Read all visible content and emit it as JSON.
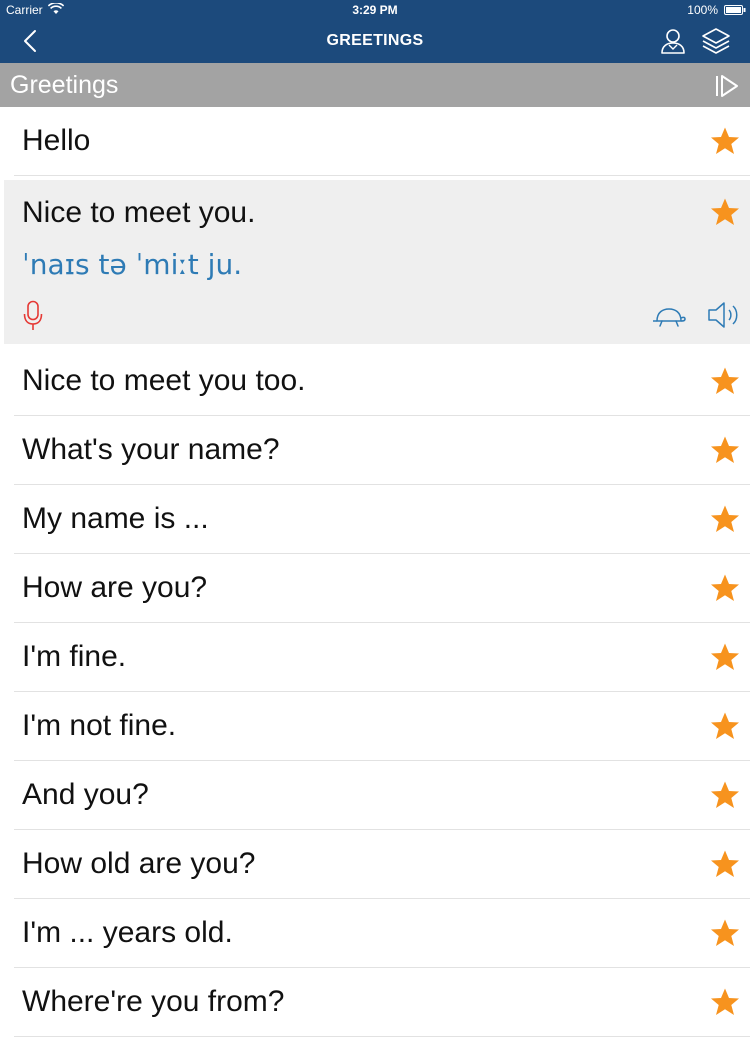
{
  "status_bar": {
    "carrier": "Carrier",
    "time": "3:29 PM",
    "battery": "100%"
  },
  "nav": {
    "title": "GREETINGS",
    "back_icon": "chevron-left-icon",
    "user_icon": "user-icon",
    "layers_icon": "layers-icon"
  },
  "section": {
    "label": "Greetings",
    "play_icon": "play-all-icon"
  },
  "colors": {
    "nav_bar": "#1c4a7c",
    "section_header": "#a3a3a3",
    "star": "#f7931e",
    "ipa_text": "#2e7bb5",
    "mic": "#e53935",
    "expanded_row": "#efefef"
  },
  "phrases": [
    {
      "text": "Hello"
    },
    {
      "text": "Nice to meet you.",
      "ipa": "ˈnaɪs tə ˈmiːt ju."
    },
    {
      "text": "Nice to meet you too."
    },
    {
      "text": "What's your name?"
    },
    {
      "text": "My name is ..."
    },
    {
      "text": "How are you?"
    },
    {
      "text": "I'm fine."
    },
    {
      "text": "I'm not fine."
    },
    {
      "text": "And you?"
    },
    {
      "text": "How old are you?"
    },
    {
      "text": "I'm ... years old."
    },
    {
      "text": "Where're you from?"
    }
  ]
}
